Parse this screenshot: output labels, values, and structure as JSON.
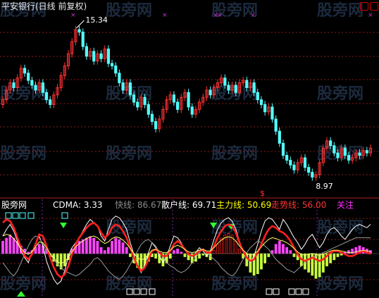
{
  "title": "平安银行(日线 前复权)",
  "watermark": "股旁网",
  "colors": {
    "up": "#ff3333",
    "down": "#54ffff",
    "grid": "#8b1a1a",
    "white_line": "#ffffff",
    "gray_line": "#9a9a9a",
    "red_line": "#ff2020",
    "yellow_line": "#ffff66",
    "green_bar": "#c8ff40",
    "magenta_bar": "#ff44ff",
    "marker": "#cc33cc"
  },
  "indicator": {
    "name": "股旁网",
    "cdma": "CDMA: 3.33",
    "kuaixian": "快线: 86.67",
    "sanhu": "散户线: 69.71",
    "zhuli": "主力线: 50.69",
    "zoushi": "走势线: 56.00",
    "guanzhu": "关注"
  },
  "chart_data": [
    {
      "type": "candlestick",
      "high_label": "15.34",
      "low_label": "8.97",
      "price_high": 15.34,
      "price_low": 8.97,
      "close": [
        12.2,
        12.6,
        12.9,
        12.7,
        13.1,
        13.5,
        13.3,
        13.0,
        12.8,
        12.6,
        12.9,
        12.5,
        12.2,
        12.0,
        12.4,
        12.7,
        13.2,
        13.6,
        14.1,
        14.6,
        15.1,
        15.0,
        14.4,
        14.0,
        14.2,
        13.8,
        14.1,
        13.9,
        14.3,
        13.7,
        13.6,
        13.3,
        12.9,
        12.6,
        12.9,
        12.4,
        12.1,
        11.9,
        12.3,
        12.0,
        11.6,
        11.3,
        11.0,
        11.4,
        11.8,
        12.2,
        12.4,
        12.1,
        11.8,
        12.3,
        12.5,
        11.9,
        11.6,
        11.8,
        12.1,
        12.3,
        12.6,
        12.4,
        12.7,
        12.9,
        13.1,
        12.8,
        12.6,
        12.8,
        12.5,
        12.9,
        13.0,
        12.7,
        12.9,
        12.5,
        12.2,
        12.0,
        11.7,
        11.9,
        11.4,
        10.9,
        10.4,
        9.9,
        9.7,
        9.5,
        9.3,
        9.6,
        9.8,
        9.4,
        9.2,
        9.0,
        9.1,
        9.6,
        10.2,
        10.5,
        10.3,
        10.0,
        9.8,
        10.2,
        9.9,
        9.7,
        9.8,
        10.0,
        9.9,
        10.1,
        10.0,
        10.2
      ],
      "markers": [
        "$"
      ]
    },
    {
      "type": "line",
      "series": [
        {
          "name": "快线",
          "values": [
            72,
            80,
            86,
            78,
            66,
            54,
            46,
            40,
            52,
            64,
            72,
            60,
            42,
            30,
            20,
            14,
            18,
            30,
            48,
            58,
            64,
            70,
            78,
            86,
            92,
            88,
            84,
            72,
            66,
            80,
            92,
            96,
            94,
            88,
            80,
            64,
            50,
            36,
            28,
            38,
            52,
            64,
            58,
            48,
            40,
            48,
            60,
            72,
            70,
            64,
            56,
            50,
            46,
            52,
            58,
            54,
            48,
            54,
            68,
            80,
            88,
            92,
            94,
            90,
            80,
            66,
            54,
            46,
            40,
            48,
            62,
            78,
            90,
            94,
            92,
            86,
            80,
            92,
            86,
            78,
            70,
            64,
            56,
            62,
            70,
            74,
            66,
            58,
            64,
            74,
            80,
            82,
            78,
            72,
            68,
            74,
            80,
            84,
            86,
            84,
            82,
            86
          ]
        },
        {
          "name": "散户线",
          "values": [
            40,
            34,
            28,
            24,
            30,
            40,
            50,
            60,
            68,
            72,
            70,
            62,
            54,
            50,
            44,
            38,
            34,
            30,
            28,
            26,
            24,
            26,
            30,
            34,
            38,
            44,
            46,
            42,
            36,
            30,
            26,
            22,
            20,
            24,
            30,
            38,
            46,
            54,
            62,
            66,
            68,
            64,
            60,
            52,
            46,
            40,
            36,
            34,
            30,
            28,
            30,
            34,
            40,
            46,
            52,
            56,
            52,
            48,
            44,
            40,
            34,
            30,
            26,
            24,
            28,
            36,
            44,
            52,
            58,
            62,
            66,
            64,
            60,
            56,
            50,
            44,
            40,
            36,
            32,
            30,
            28,
            32,
            36,
            40,
            44,
            46,
            48,
            50,
            52,
            54,
            56,
            58,
            60,
            62,
            64,
            66,
            68,
            70,
            70,
            70,
            70,
            69.71
          ]
        },
        {
          "name": "主力线",
          "values": [
            88,
            92,
            90,
            82,
            70,
            58,
            48,
            44,
            50,
            62,
            74,
            72,
            60,
            46,
            34,
            26,
            22,
            26,
            36,
            50,
            62,
            70,
            76,
            82,
            86,
            88,
            84,
            76,
            70,
            74,
            82,
            86,
            84,
            78,
            70,
            58,
            46,
            36,
            30,
            34,
            44,
            54,
            56,
            52,
            48,
            48,
            54,
            62,
            66,
            62,
            56,
            50,
            48,
            50,
            54,
            56,
            52,
            52,
            60,
            70,
            78,
            84,
            86,
            84,
            76,
            64,
            54,
            46,
            42,
            44,
            52,
            62,
            72,
            80,
            84,
            82,
            78,
            76,
            72,
            66,
            58,
            50,
            44,
            42,
            44,
            46,
            44,
            42,
            44,
            48,
            52,
            54,
            54,
            52,
            50,
            48,
            48,
            50,
            52,
            54,
            52,
            50.69
          ]
        }
      ],
      "bars": [
        8,
        10,
        12,
        10,
        8,
        5,
        3,
        1,
        2,
        4,
        6,
        5,
        3,
        -2,
        -5,
        -8,
        -10,
        -8,
        -4,
        3,
        6,
        8,
        9,
        10,
        11,
        10,
        8,
        4,
        2,
        4,
        8,
        10,
        9,
        7,
        4,
        -2,
        -6,
        -9,
        -10,
        -8,
        -5,
        -2,
        -3,
        -6,
        -8,
        -6,
        -3,
        2,
        3,
        1,
        -2,
        -4,
        -6,
        -5,
        -3,
        -1,
        -2,
        -4,
        2,
        6,
        10,
        12,
        13,
        12,
        8,
        3,
        -3,
        -8,
        -12,
        -14,
        -13,
        -10,
        -6,
        -2,
        2,
        6,
        8,
        6,
        4,
        2,
        -2,
        -4,
        -8,
        -10,
        -12,
        -14,
        -16,
        -15,
        -12,
        -8,
        -6,
        -4,
        -2,
        -1,
        1,
        2,
        3,
        4,
        5,
        4,
        3,
        2
      ],
      "ylim": [
        0,
        100
      ]
    }
  ]
}
